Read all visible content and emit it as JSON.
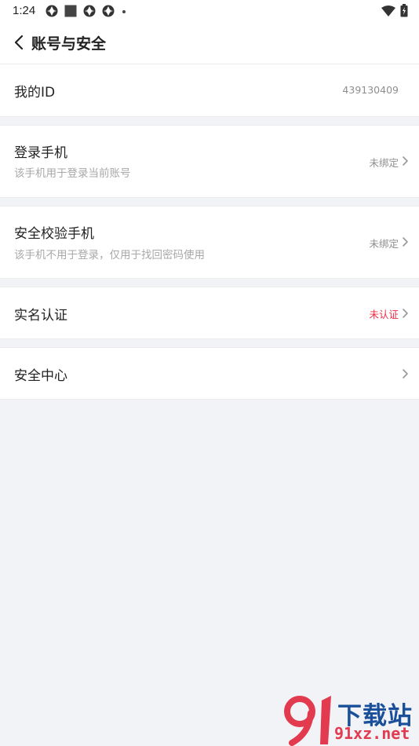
{
  "status_bar": {
    "time": "1:24",
    "left_icons": [
      "aperture-icon",
      "square-notification-icon",
      "aperture-icon",
      "aperture-icon",
      "dot-icon"
    ],
    "right_icons": [
      "wifi-icon",
      "battery-charging-icon"
    ]
  },
  "header": {
    "back_icon": "chevron-left-icon",
    "title": "账号与安全"
  },
  "rows": {
    "my_id": {
      "title": "我的ID",
      "value": "439130409"
    },
    "login_phone": {
      "title": "登录手机",
      "subtitle": "该手机用于登录当前账号",
      "value": "未绑定"
    },
    "verify_phone": {
      "title": "安全校验手机",
      "subtitle": "该手机不用于登录，仅用于找回密码使用",
      "value": "未绑定"
    },
    "real_name": {
      "title": "实名认证",
      "value": "未认证",
      "value_color": "#ef2b43"
    },
    "security_center": {
      "title": "安全中心"
    }
  },
  "watermark": {
    "text": "下载站",
    "url": "91xz.net",
    "logo": "91-logo"
  },
  "colors": {
    "background": "#f1f3f7",
    "card": "#ffffff",
    "accent_red": "#ef2b43",
    "secondary_text": "#a8a8a8"
  }
}
